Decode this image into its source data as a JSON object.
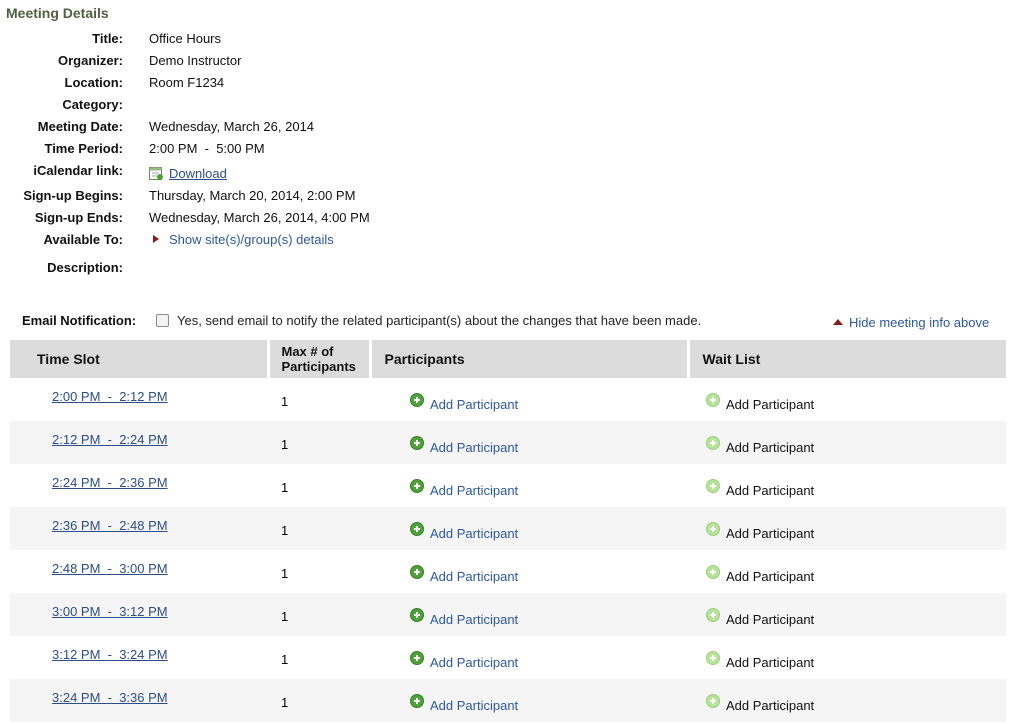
{
  "page_title": "Meeting Details",
  "details": [
    {
      "label": "Title:",
      "value": "Office Hours"
    },
    {
      "label": "Organizer:",
      "value": "Demo Instructor"
    },
    {
      "label": "Location:",
      "value": "Room F1234"
    },
    {
      "label": "Category:",
      "value": ""
    },
    {
      "label": "Meeting Date:",
      "value": "Wednesday, March 26, 2014"
    },
    {
      "label": "Time Period:",
      "value": "2:00 PM  -  5:00 PM"
    },
    {
      "label": "iCalendar link:",
      "value": "Download"
    },
    {
      "label": "Sign-up Begins:",
      "value": "Thursday, March 20, 2014, 2:00 PM"
    },
    {
      "label": "Sign-up Ends:",
      "value": "Wednesday, March 26, 2014, 4:00 PM"
    },
    {
      "label": "Available To:",
      "value": "Show site(s)/group(s) details"
    },
    {
      "label": "Description:",
      "value": ""
    }
  ],
  "email": {
    "label": "Email Notification:",
    "checked": false,
    "text": "Yes, send email to notify the related participant(s) about the changes that have been made."
  },
  "hide_link": "Hide meeting info above",
  "table": {
    "headers": {
      "time_slot": "Time Slot",
      "max_line1": "Max # of",
      "max_line2": "Participants",
      "participants": "Participants",
      "wait_list": "Wait List"
    },
    "rows": [
      {
        "slot": "2:00 PM  -  2:12 PM",
        "max": "1",
        "add": "Add Participant",
        "wait": "Add Participant"
      },
      {
        "slot": "2:12 PM  -  2:24 PM",
        "max": "1",
        "add": "Add Participant",
        "wait": "Add Participant"
      },
      {
        "slot": "2:24 PM  -  2:36 PM",
        "max": "1",
        "add": "Add Participant",
        "wait": "Add Participant"
      },
      {
        "slot": "2:36 PM  -  2:48 PM",
        "max": "1",
        "add": "Add Participant",
        "wait": "Add Participant"
      },
      {
        "slot": "2:48 PM  -  3:00 PM",
        "max": "1",
        "add": "Add Participant",
        "wait": "Add Participant"
      },
      {
        "slot": "3:00 PM  -  3:12 PM",
        "max": "1",
        "add": "Add Participant",
        "wait": "Add Participant"
      },
      {
        "slot": "3:12 PM  -  3:24 PM",
        "max": "1",
        "add": "Add Participant",
        "wait": "Add Participant"
      },
      {
        "slot": "3:24 PM  -  3:36 PM",
        "max": "1",
        "add": "Add Participant",
        "wait": "Add Participant"
      }
    ]
  },
  "colors": {
    "title_green": "#525e43",
    "link_blue": "#2c58a0",
    "header_gray": "#dcdcdc",
    "row_alt": "#f5f5f5",
    "triangle_red": "#8b1a1a"
  }
}
